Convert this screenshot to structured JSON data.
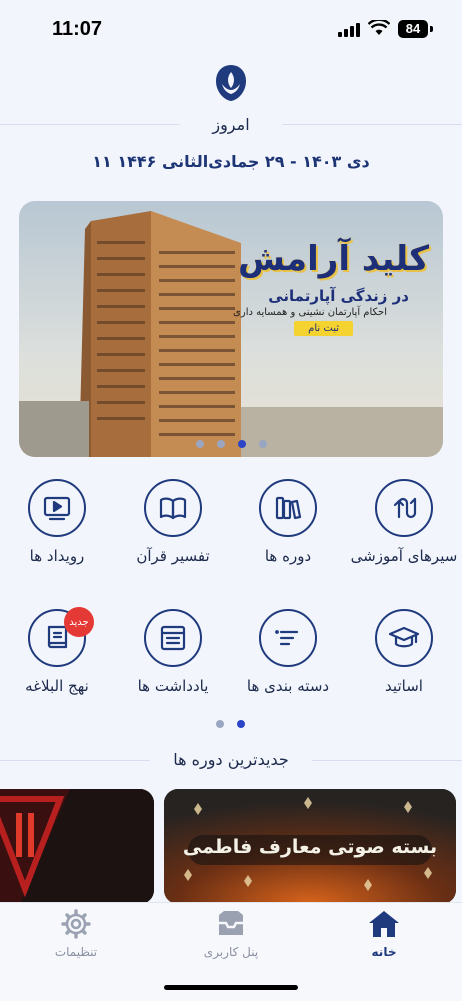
{
  "status_bar": {
    "time": "11:07",
    "battery": "84"
  },
  "today": {
    "label": "امروز",
    "date": "۱۱ دی ۱۴۰۳ - ۲۹ جمادی‌الثانی ۱۴۴۶"
  },
  "banner": {
    "title": "کلید آرامش",
    "subtitle": "در زندگی آپارتمانی",
    "description": "احکام آپارتمان نشینی و همسایه داری",
    "button": "ثبت نام",
    "slides": 4,
    "active_slide": 3
  },
  "menu": {
    "items": [
      {
        "label": "سیرهای آموزشی",
        "icon": "learning-paths-icon"
      },
      {
        "label": "دوره ها",
        "icon": "books-icon"
      },
      {
        "label": "تفسیر قرآن",
        "icon": "open-book-icon"
      },
      {
        "label": "رویداد ها",
        "icon": "video-play-icon"
      },
      {
        "label": "اساتید",
        "icon": "graduation-cap-icon"
      },
      {
        "label": "دسته بندی ها",
        "icon": "sort-lines-icon"
      },
      {
        "label": "یادداشت ها",
        "icon": "notes-icon"
      },
      {
        "label": "نهج البلاغه",
        "icon": "book-icon",
        "badge": "جدید"
      }
    ],
    "pages": 2,
    "active_page": 2
  },
  "latest_courses": {
    "title": "جدیدترین دوره ها",
    "items": [
      {
        "title": "بسته صوتی معارف فاطمی"
      }
    ]
  },
  "tabbar": {
    "tabs": [
      {
        "label": "خانه",
        "icon": "home-icon",
        "active": true
      },
      {
        "label": "پنل کاربری",
        "icon": "inbox-tray-icon",
        "active": false
      },
      {
        "label": "تنظیمات",
        "icon": "gear-icon",
        "active": false
      }
    ]
  },
  "colors": {
    "primary": "#1f3a7d",
    "accent": "#2b44c8",
    "badge": "#e53935",
    "background": "#f2f5fb"
  }
}
